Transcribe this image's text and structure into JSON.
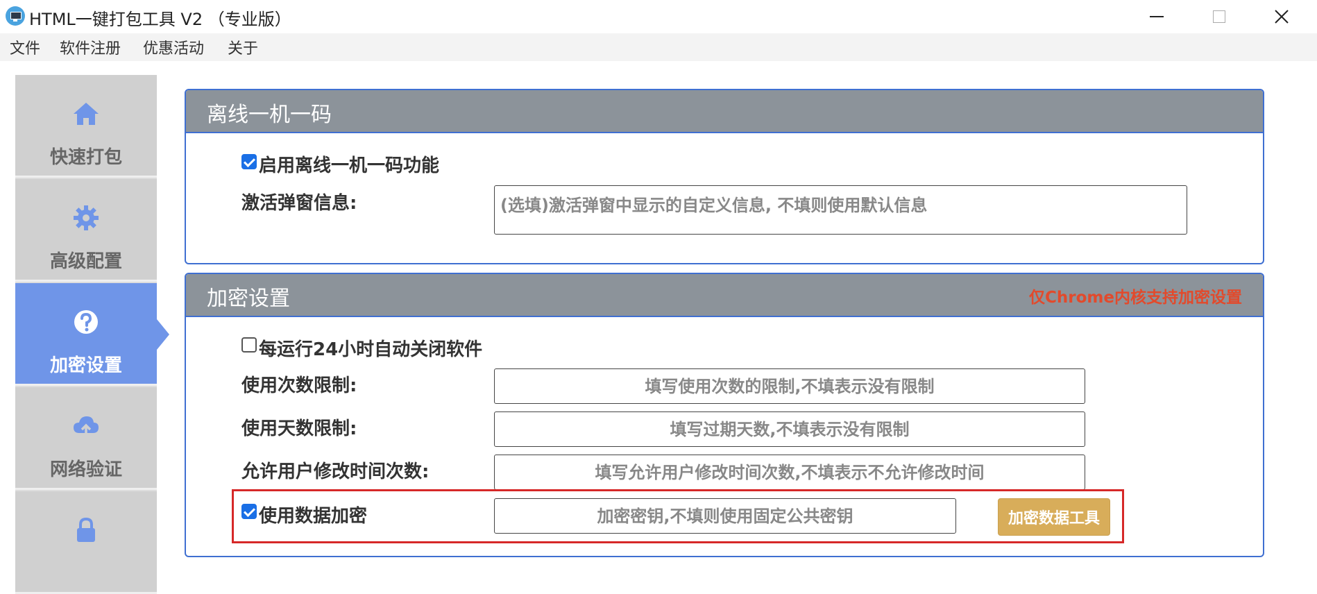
{
  "window": {
    "title": "HTML一键打包工具 V2 （专业版）",
    "icons": {
      "app": "monitor-icon",
      "minimize": "minimize-icon",
      "maximize": "maximize-icon",
      "close": "close-icon"
    }
  },
  "menu": {
    "items": [
      "文件",
      "软件注册",
      "优惠活动",
      "关于"
    ]
  },
  "sidebar": {
    "items": [
      {
        "label": "快速打包",
        "icon": "home-icon"
      },
      {
        "label": "高级配置",
        "icon": "gear-icon"
      },
      {
        "label": "加密设置",
        "icon": "question-icon",
        "active": true
      },
      {
        "label": "网络验证",
        "icon": "cloud-upload-icon"
      },
      {
        "label": "",
        "icon": "lock-icon"
      }
    ],
    "active_color": "#6f95e8"
  },
  "offline_panel": {
    "title": "离线一机一码",
    "enable_label": "启用离线一机一码功能",
    "enable_checked": true,
    "popup_label": "激活弹窗信息:",
    "popup_placeholder": "(选填)激活弹窗中显示的自定义信息, 不填则使用默认信息"
  },
  "encrypt_panel": {
    "title": "加密设置",
    "note": "仅Chrome内核支持加密设置",
    "note_color": "#e24a2c",
    "auto_close_label": "每运行24小时自动关闭软件",
    "auto_close_checked": false,
    "usage_count_label": "使用次数限制:",
    "usage_count_placeholder": "填写使用次数的限制,不填表示没有限制",
    "usage_days_label": "使用天数限制:",
    "usage_days_placeholder": "填写过期天数,不填表示没有限制",
    "time_modify_label": "允许用户修改时间次数:",
    "time_modify_placeholder": "填写允许用户修改时间次数,不填表示不允许修改时间",
    "data_encrypt_label": "使用数据加密",
    "data_encrypt_checked": true,
    "key_placeholder": "加密密钥,不填则使用固定公共密钥",
    "tool_button": "加密数据工具"
  },
  "colors": {
    "panel_border": "#3f6fd1",
    "panel_header": "#8c939a",
    "tool_button": "#d8ad5a",
    "highlight": "#d62828"
  }
}
